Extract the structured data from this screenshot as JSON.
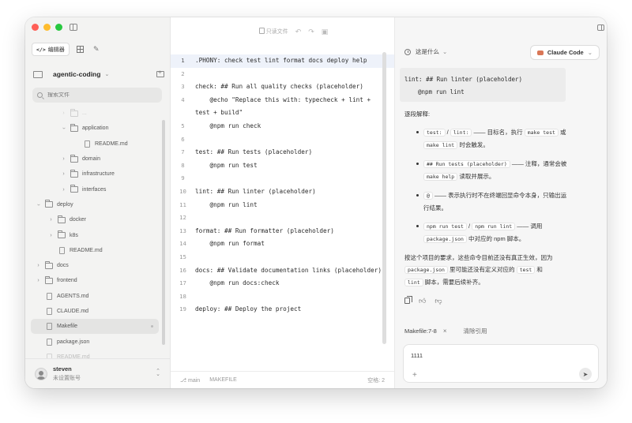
{
  "sidebar": {
    "mode_label": "编辑器",
    "mode_glyph": "</>",
    "project_name": "agentic-coding",
    "search_placeholder": "搜索文件",
    "tree": [
      {
        "type": "folder",
        "name": "...",
        "depth": 2,
        "open": false,
        "fade": true
      },
      {
        "type": "folder",
        "name": "application",
        "depth": 2,
        "open": true
      },
      {
        "type": "file",
        "name": "README.md",
        "depth": 3
      },
      {
        "type": "folder",
        "name": "domain",
        "depth": 2,
        "open": false
      },
      {
        "type": "folder",
        "name": "infrastructure",
        "depth": 2,
        "open": false
      },
      {
        "type": "folder",
        "name": "interfaces",
        "depth": 2,
        "open": false
      },
      {
        "type": "folder",
        "name": "deploy",
        "depth": 0,
        "open": true
      },
      {
        "type": "folder",
        "name": "docker",
        "depth": 1,
        "open": false
      },
      {
        "type": "folder",
        "name": "k8s",
        "depth": 1,
        "open": false
      },
      {
        "type": "file",
        "name": "README.md",
        "depth": 1
      },
      {
        "type": "folder",
        "name": "docs",
        "depth": 0,
        "open": false
      },
      {
        "type": "folder",
        "name": "frontend",
        "depth": 0,
        "open": false
      },
      {
        "type": "file",
        "name": "AGENTS.md",
        "depth": 0
      },
      {
        "type": "file",
        "name": "CLAUDE.md",
        "depth": 0
      },
      {
        "type": "file",
        "name": "Makefile",
        "depth": 0,
        "selected": true
      },
      {
        "type": "file",
        "name": "package.json",
        "depth": 0
      },
      {
        "type": "file",
        "name": "README.md",
        "depth": 0,
        "fade": true
      }
    ],
    "user": {
      "name": "steven",
      "subtitle": "未设置账号"
    }
  },
  "editor": {
    "readonly_label": "只读文件",
    "lines": [
      {
        "n": "1",
        "text": ".PHONY: check test lint format docs deploy help",
        "current": true
      },
      {
        "n": "2",
        "text": ""
      },
      {
        "n": "3",
        "text": "check: ## Run all quality checks (placeholder)"
      },
      {
        "n": "4",
        "text": "    @echo \"Replace this with: typecheck + lint + test + build\""
      },
      {
        "n": "5",
        "text": "    @npm run check"
      },
      {
        "n": "6",
        "text": ""
      },
      {
        "n": "7",
        "text": "test: ## Run tests (placeholder)"
      },
      {
        "n": "8",
        "text": "    @npm run test"
      },
      {
        "n": "9",
        "text": ""
      },
      {
        "n": "10",
        "text": "lint: ## Run linter (placeholder)"
      },
      {
        "n": "11",
        "text": "    @npm run lint"
      },
      {
        "n": "12",
        "text": ""
      },
      {
        "n": "13",
        "text": "format: ## Run formatter (placeholder)"
      },
      {
        "n": "14",
        "text": "    @npm run format"
      },
      {
        "n": "15",
        "text": ""
      },
      {
        "n": "16",
        "text": "docs: ## Validate documentation links (placeholder)"
      },
      {
        "n": "17",
        "text": "    @npm run docs:check"
      },
      {
        "n": "18",
        "text": ""
      },
      {
        "n": "19",
        "text": "deploy: ## Deploy the project"
      }
    ],
    "status": {
      "branch": "main",
      "language": "MAKEFILE",
      "spaces": "空格: 2"
    }
  },
  "assistant": {
    "context_label": "这是什么",
    "agent_name": "Claude Code",
    "code_line1": "lint: ## Run linter (placeholder)",
    "code_line2": "@npm run lint",
    "intro": "逐段解释:",
    "outro_a": "按这个项目的要求，这些命令目前还没有真正生效，因为 ",
    "outro_code1": "package.json",
    "outro_b": " 里可能还没有定义对应的 ",
    "outro_code2": "test",
    "outro_c": " 和 ",
    "outro_code3": "lint",
    "outro_d": " 脚本，需要后续补齐。",
    "reference": "Makefile:7-8",
    "clear_label": "清除引用",
    "input_value": "1111"
  }
}
